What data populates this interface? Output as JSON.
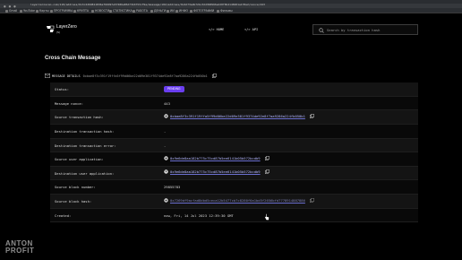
{
  "browser": {
    "url": "layerzeroscan.com/110/address/0x3c2269811836af69497e5f486a85d7316753cf9a/message/102/address/0x4d73adb72bc3dd368966edd0f0b2148401a178e2/nonce/443",
    "bookmarks": [
      "Gmail",
      "YouTube",
      "Карты",
      "ПРОГРАММЫ",
      "КРИПТА",
      "НОВОСТИ",
      "СТАТИСТИКА",
      "РАБОТА",
      "ДЕНЬГИ",
      "ИИ",
      "ИНФО",
      "ФОТОГРАФИИ",
      "Фильмы"
    ]
  },
  "header": {
    "logo_text": "LayerZero",
    "logo_sub": "(S)",
    "nav": [
      {
        "label": "</> HOME"
      },
      {
        "label": "</> API"
      }
    ],
    "search_placeholder": "Search by transaction hash"
  },
  "page": {
    "title": "Cross Chain Message",
    "details_label": "MESSAGE DETAILS",
    "details_hash": "0xbae8f3c391f19ffa5f99d06be22d09e381f9374de92e8f7aa9286a224fb050b1"
  },
  "rows": [
    {
      "label": "Status:",
      "value": "PENDING"
    },
    {
      "label": "Message nonce:",
      "value": "443"
    },
    {
      "label": "Source transaction hash:",
      "value": "0xbae8f3c391f19ffa5f99d06be22d09e381f9374de92e8f7aa9286a224fb050b1"
    },
    {
      "label": "Destination transaction hash:",
      "value": "-"
    },
    {
      "label": "Destination transaction error:",
      "value": "-"
    },
    {
      "label": "Source user application:",
      "value": "0x9e6de8aa182b775c75cd87b5ee6141b05b572bcdb9"
    },
    {
      "label": "Destination user application:",
      "value": "0x9e6de8aa182b775c75cd87b5ee6141b05b572bcdb9"
    },
    {
      "label": "Source block number:",
      "value": "29855783"
    },
    {
      "label": "Source block hash:",
      "value": "0x7269df9acfad8dbd5ceca12b5477cb7c8280f6a1bd5f2656bfd7778914887886"
    },
    {
      "label": "Created:",
      "value": "now, Fri, 14 Jul 2023 12:39:30 GMT"
    }
  ],
  "watermark": {
    "line1": "ANTON",
    "line2": "PROFIT"
  },
  "colors": {
    "accent": "#6a3ef0",
    "link": "#b3b6ff",
    "background": "#000000"
  }
}
